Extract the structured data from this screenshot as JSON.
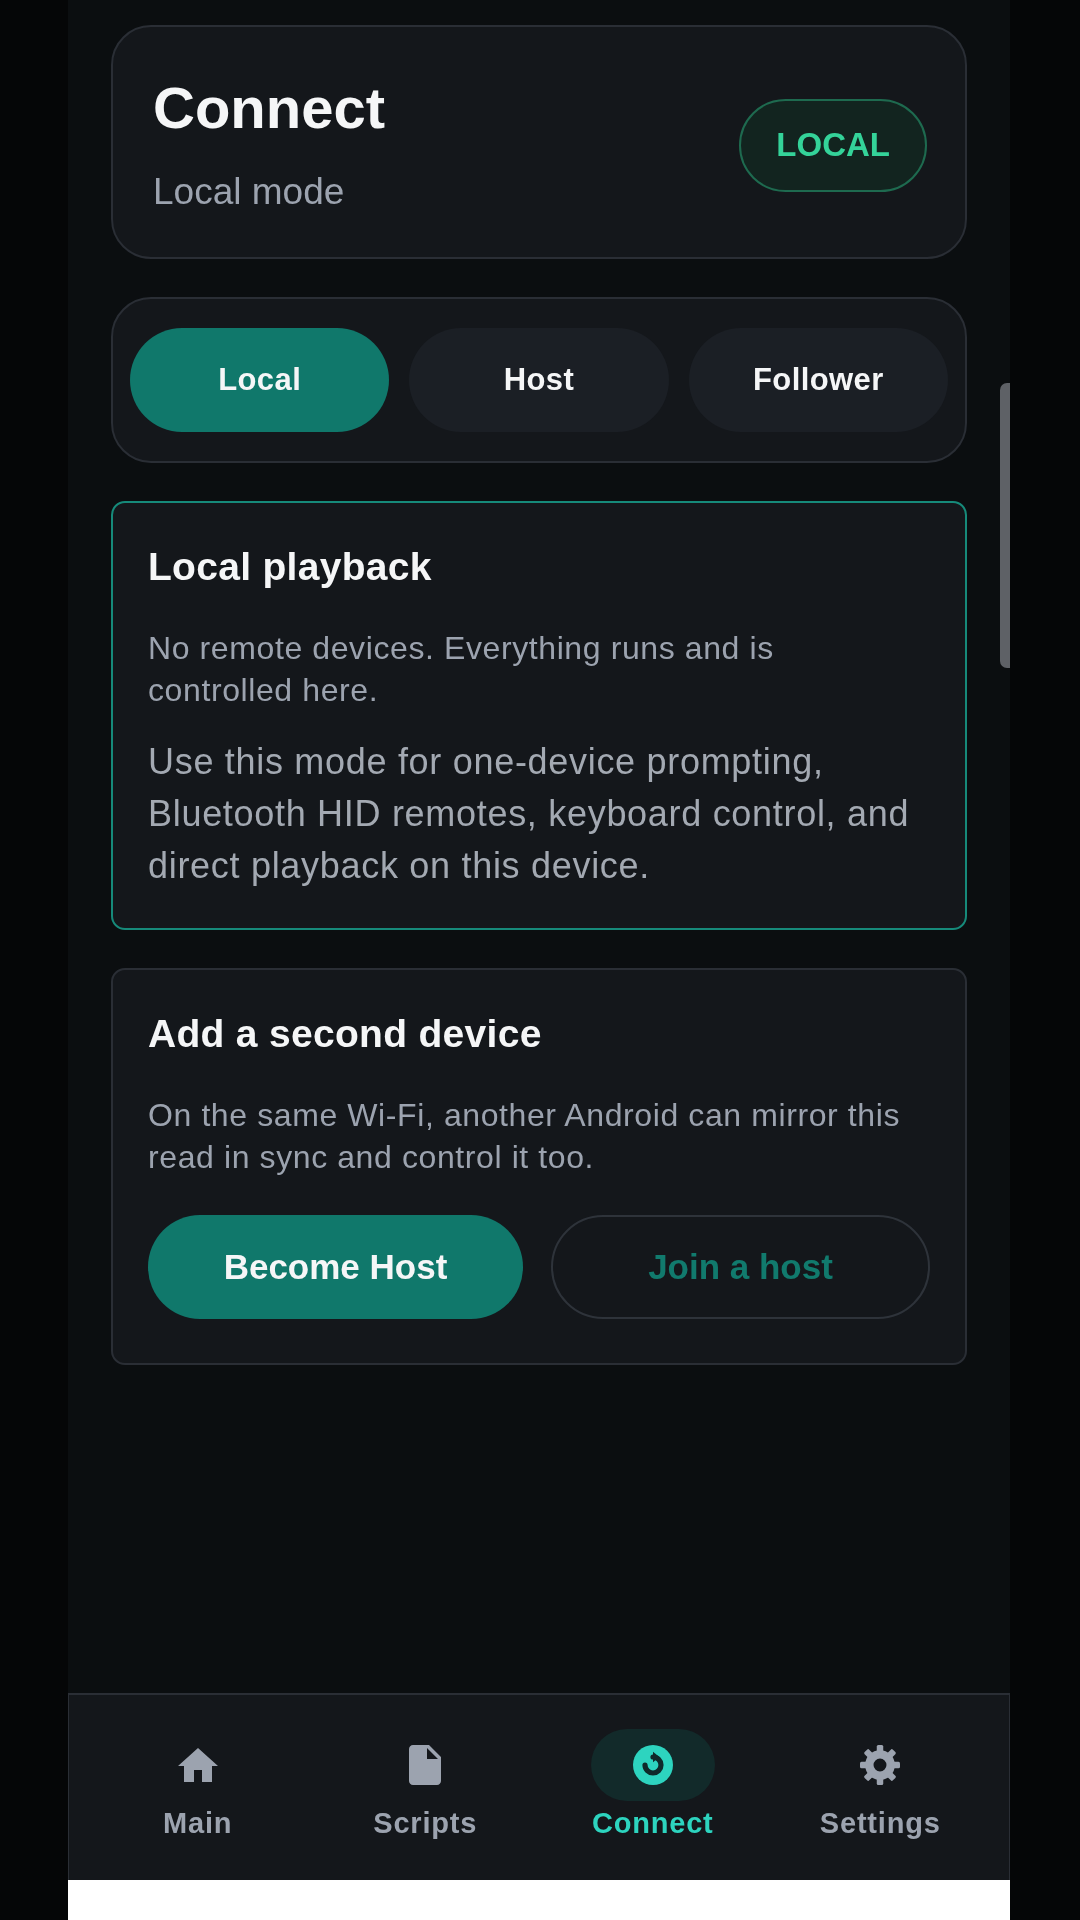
{
  "header": {
    "title": "Connect",
    "subtitle": "Local mode",
    "badge": "LOCAL"
  },
  "mode_tabs": [
    {
      "label": "Local",
      "selected": true
    },
    {
      "label": "Host",
      "selected": false
    },
    {
      "label": "Follower",
      "selected": false
    }
  ],
  "cards": [
    {
      "title": "Local playback",
      "highlighted": true,
      "description": "No remote devices. Everything runs and is controlled here.",
      "details": "Use this mode for one-device prompting, Bluetooth HID remotes, keyboard control, and direct playback on this device."
    },
    {
      "title": "Add a second device",
      "highlighted": false,
      "description": "On the same Wi-Fi, another Android can mirror this read in sync and control it too.",
      "actions": [
        {
          "label": "Become Host",
          "kind": "primary"
        },
        {
          "label": "Join a host",
          "kind": "outline"
        }
      ]
    }
  ],
  "bottom_nav": [
    {
      "label": "Main",
      "selected": false
    },
    {
      "label": "Scripts",
      "selected": false
    },
    {
      "label": "Connect",
      "selected": true
    },
    {
      "label": "Settings",
      "selected": false
    }
  ]
}
